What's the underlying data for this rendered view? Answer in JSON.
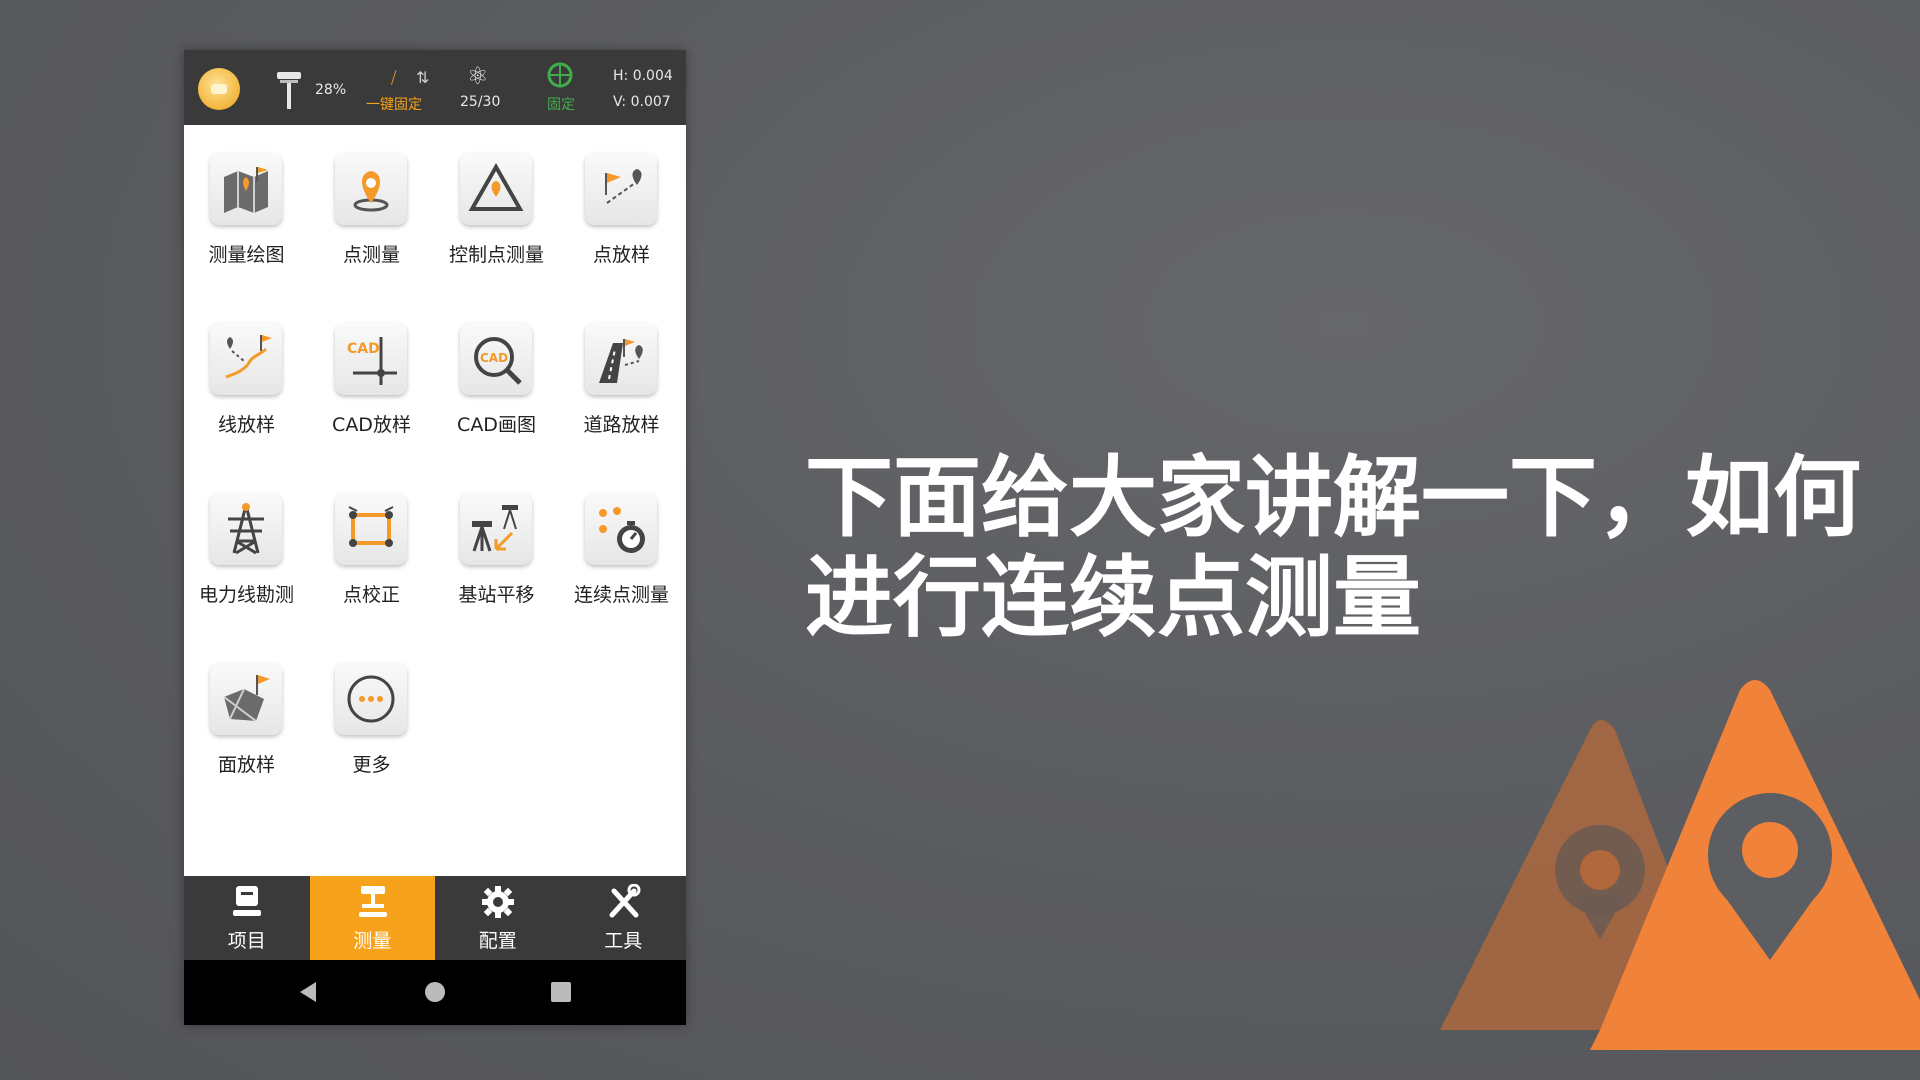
{
  "status": {
    "battery_percent": "28%",
    "fix_button": "一键固定",
    "satellites": "25/30",
    "solution": "固定",
    "h_precision": "H: 0.004",
    "v_precision": "V: 0.007"
  },
  "apps": [
    {
      "label": "测量绘图",
      "icon": "survey-map-icon"
    },
    {
      "label": "点测量",
      "icon": "point-survey-icon"
    },
    {
      "label": "控制点测量",
      "icon": "control-point-icon"
    },
    {
      "label": "点放样",
      "icon": "point-stakeout-icon"
    },
    {
      "label": "线放样",
      "icon": "line-stakeout-icon"
    },
    {
      "label": "CAD放样",
      "icon": "cad-stakeout-icon"
    },
    {
      "label": "CAD画图",
      "icon": "cad-draw-icon"
    },
    {
      "label": "道路放样",
      "icon": "road-stakeout-icon"
    },
    {
      "label": "电力线勘测",
      "icon": "power-line-icon"
    },
    {
      "label": "点校正",
      "icon": "point-calibration-icon"
    },
    {
      "label": "基站平移",
      "icon": "base-shift-icon"
    },
    {
      "label": "连续点测量",
      "icon": "continuous-point-icon"
    },
    {
      "label": "面放样",
      "icon": "area-stakeout-icon"
    },
    {
      "label": "更多",
      "icon": "more-icon"
    }
  ],
  "tabs": [
    {
      "label": "项目",
      "icon": "project-icon",
      "active": false
    },
    {
      "label": "测量",
      "icon": "survey-icon",
      "active": true
    },
    {
      "label": "配置",
      "icon": "gear-icon",
      "active": false
    },
    {
      "label": "工具",
      "icon": "tools-icon",
      "active": false
    }
  ],
  "caption": {
    "line1": "下面给大家讲解一下，如何",
    "line2": "进行连续点测量"
  },
  "colors": {
    "accent": "#f7a21b",
    "background": "#5d5e62",
    "statusbar": "#3a3a3a",
    "fixed_green": "#3fae4a"
  }
}
